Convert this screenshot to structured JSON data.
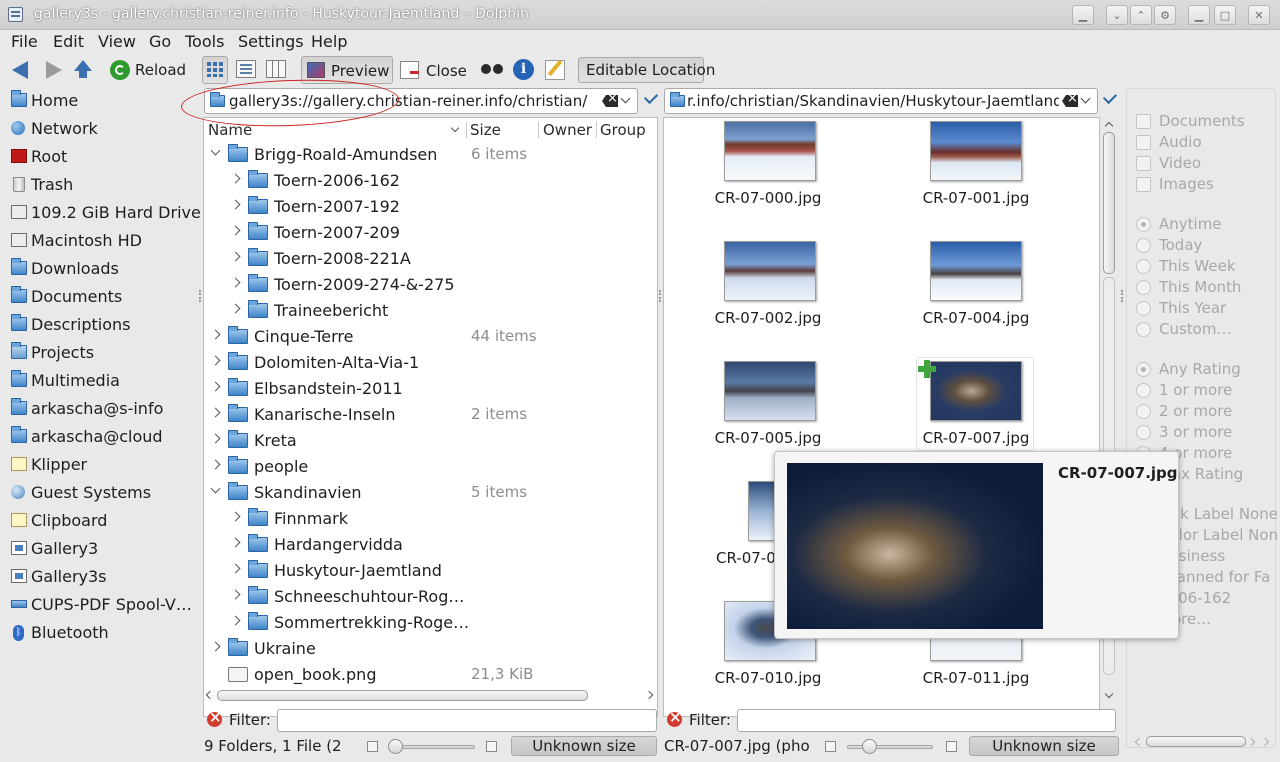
{
  "window": {
    "title": "gallery3s - gallery.christian-reiner.info - Huskytour-Jaemtland – Dolphin"
  },
  "menu": [
    "File",
    "Edit",
    "View",
    "Go",
    "Tools",
    "Settings",
    "Help"
  ],
  "toolbar": {
    "reload": "Reload",
    "preview": "Preview",
    "close": "Close",
    "editable_location": "Editable Location"
  },
  "places": [
    {
      "label": "Home",
      "icon": "home-folder-icon"
    },
    {
      "label": "Network",
      "icon": "network-icon"
    },
    {
      "label": "Root",
      "icon": "root-folder-icon"
    },
    {
      "label": "Trash",
      "icon": "trash-icon"
    },
    {
      "label": "109.2 GiB Hard Drive",
      "icon": "hard-drive-icon"
    },
    {
      "label": "Macintosh HD",
      "icon": "hard-drive-icon"
    },
    {
      "label": "Downloads",
      "icon": "folder-icon"
    },
    {
      "label": "Documents",
      "icon": "folder-icon"
    },
    {
      "label": "Descriptions",
      "icon": "folder-icon"
    },
    {
      "label": "Projects",
      "icon": "projects-icon"
    },
    {
      "label": "Multimedia",
      "icon": "folder-icon"
    },
    {
      "label": "arkascha@s-info",
      "icon": "remote-folder-icon"
    },
    {
      "label": "arkascha@cloud",
      "icon": "remote-folder-icon"
    },
    {
      "label": "Klipper",
      "icon": "clipboard-folder-icon"
    },
    {
      "label": "Guest Systems",
      "icon": "network-icon"
    },
    {
      "label": "Clipboard",
      "icon": "clipboard-folder-icon"
    },
    {
      "label": "Gallery3",
      "icon": "gallery-icon"
    },
    {
      "label": "Gallery3s",
      "icon": "gallery-icon"
    },
    {
      "label": "CUPS-PDF Spool-V…",
      "icon": "printer-icon"
    },
    {
      "label": "Bluetooth",
      "icon": "bluetooth-icon"
    }
  ],
  "left_pane": {
    "location": "gallery3s://gallery.christian-reiner.info/christian/",
    "columns": {
      "name": "Name",
      "size": "Size",
      "owner": "Owner",
      "group": "Group"
    },
    "rows": [
      {
        "name": "Brigg-Roald-Amundsen",
        "size": "6 items",
        "depth": 0,
        "state": "open"
      },
      {
        "name": "Toern-2006-162",
        "size": "",
        "depth": 1,
        "state": "closed"
      },
      {
        "name": "Toern-2007-192",
        "size": "",
        "depth": 1,
        "state": "closed"
      },
      {
        "name": "Toern-2007-209",
        "size": "",
        "depth": 1,
        "state": "closed"
      },
      {
        "name": "Toern-2008-221A",
        "size": "",
        "depth": 1,
        "state": "closed"
      },
      {
        "name": "Toern-2009-274-&-275",
        "size": "",
        "depth": 1,
        "state": "closed"
      },
      {
        "name": "Traineebericht",
        "size": "",
        "depth": 1,
        "state": "closed"
      },
      {
        "name": "Cinque-Terre",
        "size": "44 items",
        "depth": 0,
        "state": "closed"
      },
      {
        "name": "Dolomiten-Alta-Via-1",
        "size": "",
        "depth": 0,
        "state": "closed"
      },
      {
        "name": "Elbsandstein-2011",
        "size": "",
        "depth": 0,
        "state": "closed"
      },
      {
        "name": "Kanarische-Inseln",
        "size": "2 items",
        "depth": 0,
        "state": "closed"
      },
      {
        "name": "Kreta",
        "size": "",
        "depth": 0,
        "state": "closed"
      },
      {
        "name": "people",
        "size": "",
        "depth": 0,
        "state": "closed"
      },
      {
        "name": "Skandinavien",
        "size": "5 items",
        "depth": 0,
        "state": "open"
      },
      {
        "name": "Finnmark",
        "size": "",
        "depth": 1,
        "state": "closed"
      },
      {
        "name": "Hardangervidda",
        "size": "",
        "depth": 1,
        "state": "closed"
      },
      {
        "name": "Huskytour-Jaemtland",
        "size": "",
        "depth": 1,
        "state": "closed"
      },
      {
        "name": "Schneeschuhtour-Rog…",
        "size": "",
        "depth": 1,
        "state": "closed"
      },
      {
        "name": "Sommertrekking-Roge…",
        "size": "",
        "depth": 1,
        "state": "closed"
      },
      {
        "name": "Ukraine",
        "size": "",
        "depth": 0,
        "state": "closed"
      },
      {
        "name": "open_book.png",
        "size": "21,3 KiB",
        "depth": 0,
        "state": "file"
      }
    ],
    "filter_label": "Filter:",
    "status": "9 Folders, 1 File (2",
    "space": "Unknown size"
  },
  "right_pane": {
    "location": "r.info/christian/Skandinavien/Huskytour-Jaemtland/",
    "items": [
      {
        "name": "CR-07-000.jpg"
      },
      {
        "name": "CR-07-001.jpg"
      },
      {
        "name": "CR-07-002.jpg"
      },
      {
        "name": "CR-07-004.jpg"
      },
      {
        "name": "CR-07-005.jpg"
      },
      {
        "name": "CR-07-007.jpg"
      },
      {
        "name": "CR-07-0"
      },
      {
        "name": ""
      },
      {
        "name": "CR-07-010.jpg"
      },
      {
        "name": "CR-07-011.jpg"
      }
    ],
    "filter_label": "Filter:",
    "status": "CR-07-007.jpg (pho",
    "space": "Unknown size"
  },
  "tooltip": {
    "title": "CR-07-007.jpg"
  },
  "info_panel": {
    "types": [
      "Documents",
      "Audio",
      "Video",
      "Images"
    ],
    "dates": [
      "Anytime",
      "Today",
      "This Week",
      "This Month",
      "This Year",
      "Custom…"
    ],
    "ratings": [
      "Any Rating",
      "1 or more",
      "2 or more",
      "3 or more",
      "4 or more",
      "Max Rating"
    ],
    "tags": [
      "Pick Label None",
      "Color Label None",
      "Business",
      "Scanned for Fa",
      "2006-162",
      "More…"
    ]
  }
}
